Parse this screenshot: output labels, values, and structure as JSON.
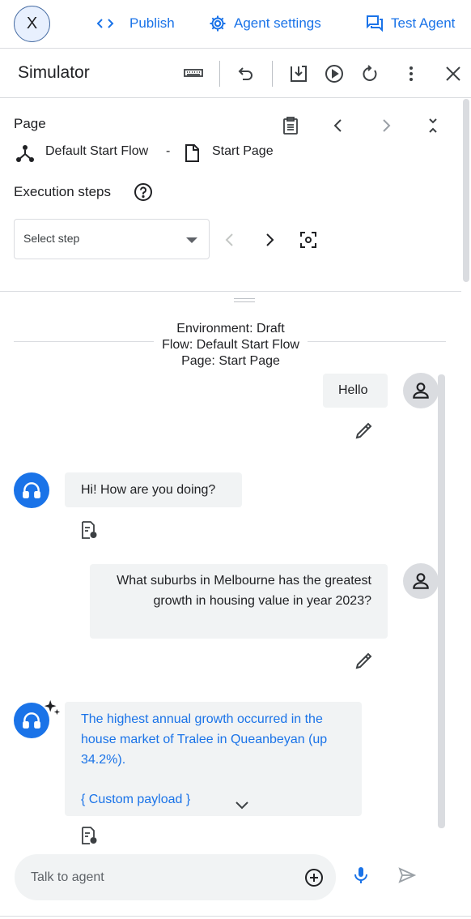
{
  "topbar": {
    "avatar_letter": "X",
    "publish_label": "Publish",
    "agent_settings_label": "Agent settings",
    "test_agent_label": "Test Agent"
  },
  "simulator": {
    "title": "Simulator"
  },
  "page_section": {
    "page_label": "Page",
    "flow_name": "Default Start Flow",
    "separator": "-",
    "page_name": "Start Page",
    "execution_steps_label": "Execution steps",
    "select_placeholder": "Select step"
  },
  "environment": {
    "line1": "Environment: Draft",
    "line2": "Flow: Default Start Flow",
    "line3": "Page: Start Page"
  },
  "messages": {
    "user1": "Hello",
    "agent1": "Hi! How are you doing?",
    "user2": "What suburbs in Melbourne has the greatest growth in housing value in year 2023?",
    "agent2": "The highest annual growth occurred in the house market of Tralee in Queanbeyan (up 34.2%).",
    "agent2_payload": "{ Custom payload }"
  },
  "input": {
    "placeholder": "Talk to agent"
  },
  "colors": {
    "accent": "#1a73e8",
    "bubble": "#f1f3f4",
    "divider": "#dadce0"
  }
}
